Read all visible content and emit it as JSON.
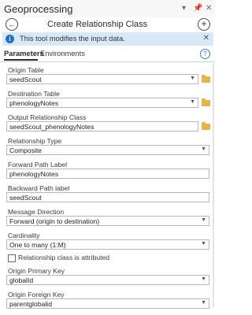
{
  "app": {
    "title": "Geoprocessing",
    "pin_icon": "pin-icon",
    "close_icon": "close-icon"
  },
  "tool": {
    "title": "Create Relationship Class"
  },
  "info": {
    "text": "This tool modifies the input data."
  },
  "tabs": [
    {
      "label": "Parameters",
      "active": true
    },
    {
      "label": "Environments",
      "active": false
    }
  ],
  "params": {
    "origin_table": {
      "label": "Origin Table",
      "value": "seedScout"
    },
    "destination_table": {
      "label": "Destination Table",
      "value": "phenologyNotes"
    },
    "output_rc": {
      "label": "Output Relationship Class",
      "value": "seedScout_phenologyNotes"
    },
    "relationship_type": {
      "label": "Relationship Type",
      "value": "Composite"
    },
    "forward_label": {
      "label": "Forward Path Label",
      "value": "phenologyNotes"
    },
    "backward_label": {
      "label": "Backward Path label",
      "value": "seedScout"
    },
    "message_direction": {
      "label": "Message Direction",
      "value": "Forward (origin to destination)"
    },
    "cardinality": {
      "label": "Cardinality",
      "value": "One to many (1:M)"
    },
    "attributed": {
      "label": "Relationship class is attributed",
      "checked": false
    },
    "origin_pk": {
      "label": "Origin Primary Key",
      "value": "globalId"
    },
    "origin_fk": {
      "label": "Origin Foreign Key",
      "value": "parentglobalid"
    }
  },
  "colors": {
    "info_bg": "#d7e8f6",
    "info_icon": "#2a6fb8",
    "folder": "#e6b54a"
  }
}
